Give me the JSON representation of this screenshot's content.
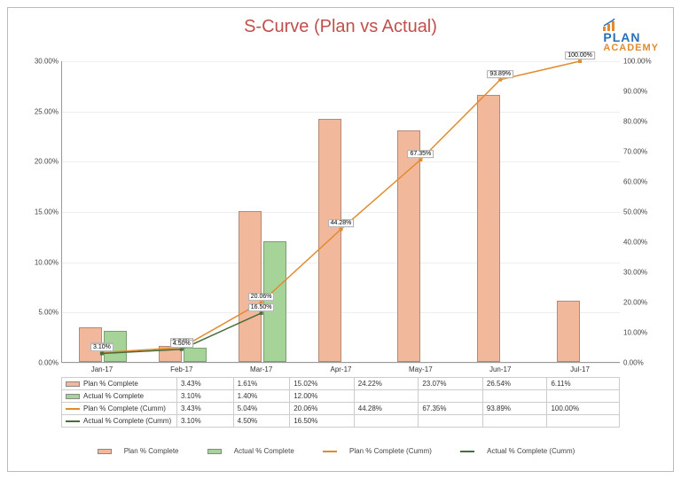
{
  "title": "S-Curve (Plan vs Actual)",
  "logo": {
    "line1": "PLAN",
    "line2": "ACADEMY"
  },
  "legend": {
    "plan_bar": "Plan % Complete",
    "actual_bar": "Actual % Complete",
    "plan_cumm": "Plan % Complete (Cumm)",
    "actual_cumm": "Actual % Complete (Cumm)"
  },
  "colors": {
    "plan_bar": "#f2b89b",
    "actual_bar": "#a6d498",
    "plan_line": "#e08b2e",
    "actual_line": "#4a6b3a",
    "title": "#c0504d"
  },
  "chart_data": {
    "type": "bar",
    "categories": [
      "Jan-17",
      "Feb-17",
      "Mar-17",
      "Apr-17",
      "May-17",
      "Jun-17",
      "Jul-17"
    ],
    "series": [
      {
        "name": "Plan % Complete",
        "values": [
          3.43,
          1.61,
          15.02,
          24.22,
          23.07,
          26.54,
          6.11
        ]
      },
      {
        "name": "Actual % Complete",
        "values": [
          3.1,
          1.4,
          12.0,
          null,
          null,
          null,
          null
        ]
      },
      {
        "name": "Plan % Complete (Cumm)",
        "values": [
          3.43,
          5.04,
          20.06,
          44.28,
          67.35,
          93.89,
          100.0
        ]
      },
      {
        "name": "Actual % Complete (Cumm)",
        "values": [
          3.1,
          4.5,
          16.5,
          null,
          null,
          null,
          null
        ]
      }
    ],
    "point_labels": {
      "plan_cumm": [
        "3.43%",
        "5.04%",
        "20.06%",
        "44.28%",
        "67.35%",
        "93.89%",
        "100.00%"
      ],
      "actual_cumm": [
        "3.10%",
        "4.50%",
        "16.50%"
      ]
    },
    "y_left": {
      "min": 0,
      "max": 30,
      "step": 5,
      "ticks": [
        "0.00%",
        "5.00%",
        "10.00%",
        "15.00%",
        "20.00%",
        "25.00%",
        "30.00%"
      ]
    },
    "y_right": {
      "min": 0,
      "max": 100,
      "step": 10,
      "ticks": [
        "0.00%",
        "10.00%",
        "20.00%",
        "30.00%",
        "40.00%",
        "50.00%",
        "60.00%",
        "70.00%",
        "80.00%",
        "90.00%",
        "100.00%"
      ]
    },
    "xlabel": "",
    "ylabel": ""
  },
  "table": {
    "rows": [
      {
        "label": "Plan % Complete",
        "cells": [
          "3.43%",
          "1.61%",
          "15.02%",
          "24.22%",
          "23.07%",
          "26.54%",
          "6.11%"
        ]
      },
      {
        "label": "Actual % Complete",
        "cells": [
          "3.10%",
          "1.40%",
          "12.00%",
          "",
          "",
          "",
          ""
        ]
      },
      {
        "label": "Plan % Complete (Cumm)",
        "cells": [
          "3.43%",
          "5.04%",
          "20.06%",
          "44.28%",
          "67.35%",
          "93.89%",
          "100.00%"
        ]
      },
      {
        "label": "Actual % Complete (Cumm)",
        "cells": [
          "3.10%",
          "4.50%",
          "16.50%",
          "",
          "",
          "",
          ""
        ]
      }
    ]
  }
}
